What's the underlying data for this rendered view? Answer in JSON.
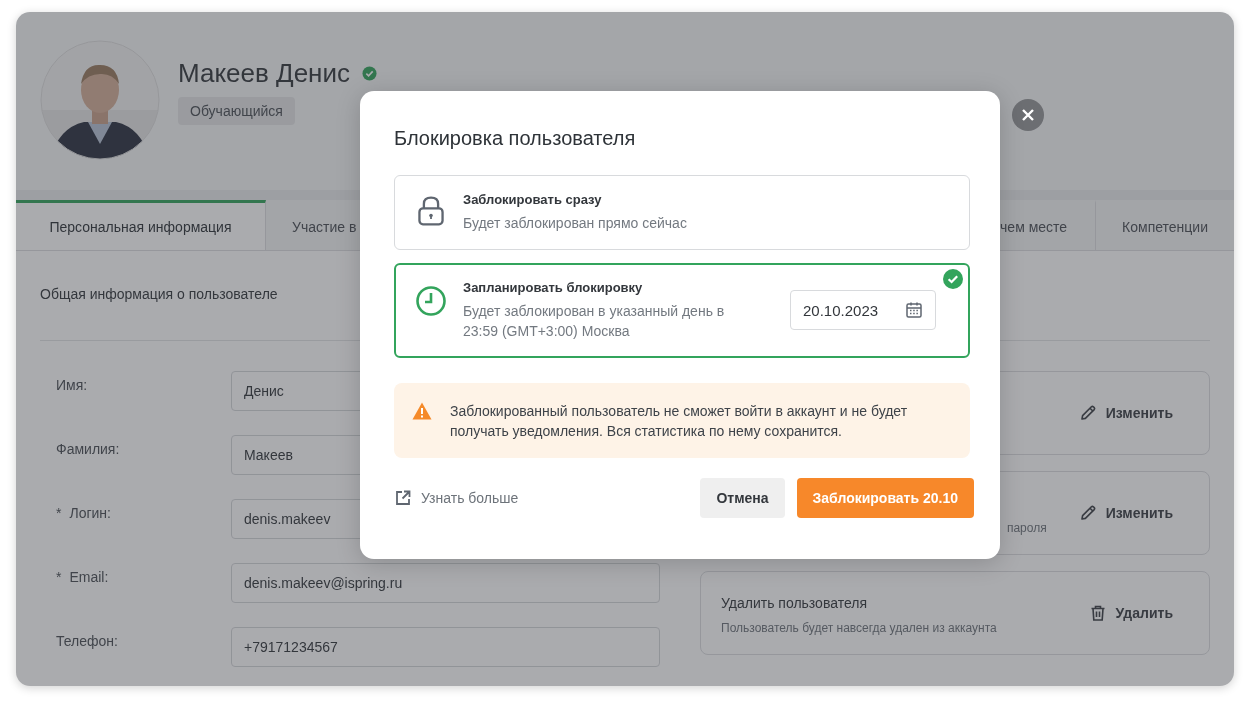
{
  "profile": {
    "name": "Макеев Денис",
    "verified": true,
    "role": "Обучающийся"
  },
  "tabs": [
    {
      "label": "Персональная информация",
      "selected": true
    },
    {
      "label": "Участие в",
      "selected": false
    },
    {
      "label": "чем месте",
      "selected": false
    },
    {
      "label": "Компетенции",
      "selected": false
    }
  ],
  "section_title": "Общая информация о пользователе",
  "fields": [
    {
      "label": "Имя:",
      "value": "Денис"
    },
    {
      "label": "Фамилия:",
      "value": "Макеев"
    },
    {
      "mark": "*",
      "label": "Логин:",
      "value": "denis.makeev"
    },
    {
      "mark": "*",
      "label": "Email:",
      "value": "denis.makeev@ispring.ru"
    },
    {
      "label": "Телефон:",
      "value": "+79171234567"
    }
  ],
  "actions": [
    {
      "kind": "edit",
      "action": "Изменить"
    },
    {
      "kind": "edit",
      "description": "пароля",
      "action": "Изменить"
    },
    {
      "kind": "delete",
      "title": "Удалить пользователя",
      "description": "Пользователь будет навсегда удален из аккаунта",
      "action": "Удалить"
    }
  ],
  "dialog": {
    "title": "Блокировка пользователя",
    "options": [
      {
        "title": "Заблокировать сразу",
        "description": "Будет заблокирован прямо сейчас",
        "selected": false
      },
      {
        "title": "Запланировать блокировку",
        "description": "Будет заблокирован в указанный день в 23:59 (GMT+3:00) Москва",
        "selected": true,
        "date": "20.10.2023"
      }
    ],
    "warning": "Заблокированный пользователь не сможет войти в аккаунт и не будет получать уведомления. Вся статистика по нему сохранится.",
    "link": "Узнать больше",
    "buttons": [
      {
        "label": "Отмена",
        "kind": "secondary"
      },
      {
        "label": "Заблокировать 20.10",
        "kind": "primary"
      }
    ]
  }
}
